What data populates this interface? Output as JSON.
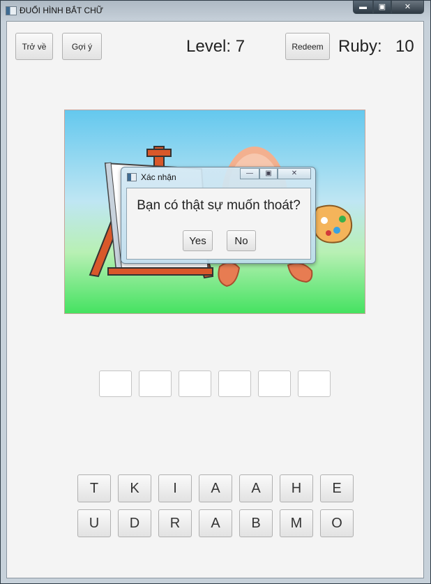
{
  "window": {
    "title": "ĐUỔI HÌNH BẮT CHỮ",
    "minimize": "▬",
    "maximize": "▣",
    "close": "✕"
  },
  "toolbar": {
    "back_label": "Trở về",
    "hint_label": "Gợi ý",
    "redeem_label": "Redeem"
  },
  "status": {
    "level_text": "Level: 7",
    "ruby_label": "Ruby:",
    "ruby_value": "10"
  },
  "answer_slots": [
    "",
    "",
    "",
    "",
    "",
    ""
  ],
  "letters": {
    "row1": [
      "T",
      "K",
      "I",
      "A",
      "A",
      "H",
      "E"
    ],
    "row2": [
      "U",
      "D",
      "R",
      "A",
      "B",
      "M",
      "O"
    ]
  },
  "dialog": {
    "title": "Xác nhận",
    "message": "Bạn có thật sự muốn thoát?",
    "yes_label": "Yes",
    "no_label": "No",
    "minimize": "—",
    "maximize": "▣",
    "close": "✕"
  },
  "colors": {
    "sky_top": "#64c8ee",
    "grass": "#45e261",
    "easel": "#d9582a",
    "face": "#f3b08f"
  }
}
